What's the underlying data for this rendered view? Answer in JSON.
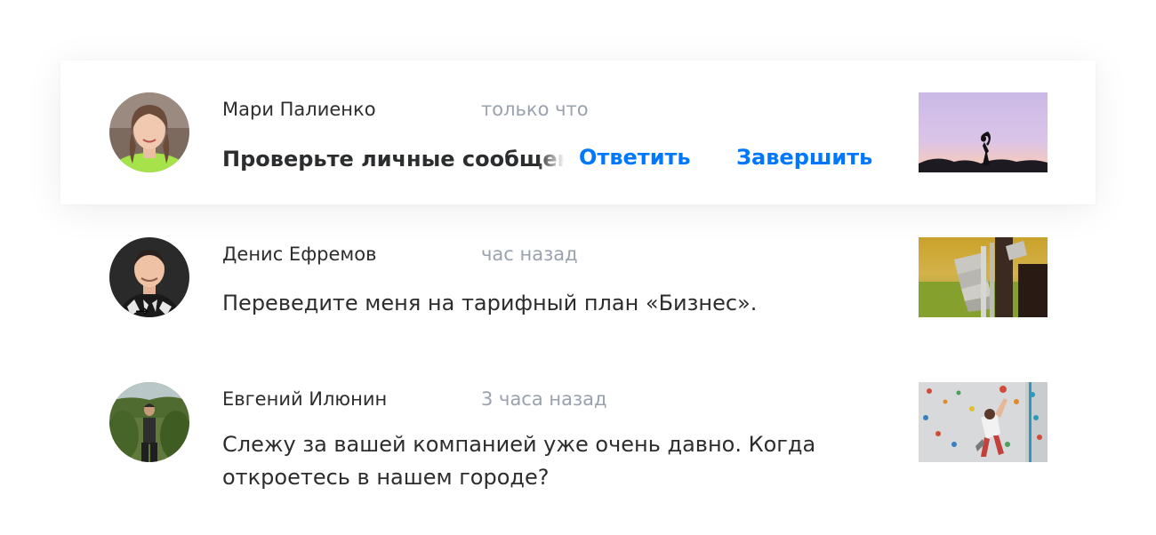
{
  "notifications": [
    {
      "name": "Мари Палиенко",
      "time": "только что",
      "message": "Проверьте личные сообщения",
      "actions": {
        "reply": "Ответить",
        "finish": "Завершить"
      }
    },
    {
      "name": "Денис Ефремов",
      "time": "час назад",
      "message": "Переведите меня на тарифный план «Бизнес».",
      "arrow": "→"
    },
    {
      "name": "Евгений Илюнин",
      "time": "3 часа назад",
      "message_line1": "Слежу за вашей компанией уже очень давно. Когда",
      "message_line2": "откроетесь в нашем городе?"
    }
  ],
  "colors": {
    "accent": "#0077ff",
    "text": "#2c2d2e",
    "secondary": "#99a2ad"
  }
}
